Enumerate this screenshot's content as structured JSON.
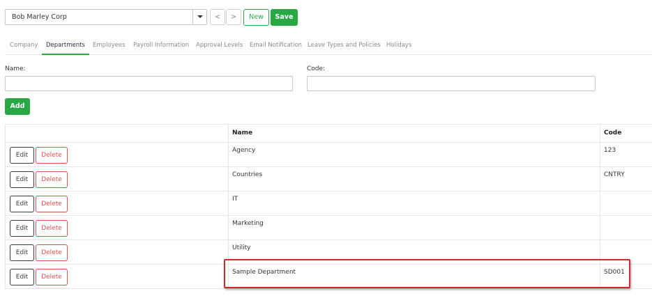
{
  "toolbar": {
    "company_value": "Bob Marley Corp",
    "prev_label": "<",
    "next_label": ">",
    "new_label": "New",
    "save_label": "Save"
  },
  "tabs": [
    {
      "label": "Company",
      "active": false
    },
    {
      "label": "Departments",
      "active": true
    },
    {
      "label": "Employees",
      "active": false
    },
    {
      "label": "Payroll Information",
      "active": false
    },
    {
      "label": "Approval Levels",
      "active": false
    },
    {
      "label": "Email Notification",
      "active": false
    },
    {
      "label": "Leave Types and Policies",
      "active": false
    },
    {
      "label": "Holidays",
      "active": false
    }
  ],
  "form": {
    "name_label": "Name:",
    "name_value": "",
    "code_label": "Code:",
    "code_value": "",
    "add_label": "Add"
  },
  "table": {
    "headers": {
      "actions": "",
      "name": "Name",
      "code": "Code"
    },
    "edit_label": "Edit",
    "delete_label": "Delete",
    "rows": [
      {
        "name": "Agency",
        "code": "123"
      },
      {
        "name": "Countries",
        "code": "CNTRY"
      },
      {
        "name": "IT",
        "code": ""
      },
      {
        "name": "Marketing",
        "code": ""
      },
      {
        "name": "Utility",
        "code": ""
      },
      {
        "name": "Sample Department",
        "code": "SD001"
      }
    ]
  },
  "colors": {
    "accent_green": "#28a745",
    "delete_red": "#d9534f",
    "highlight_red": "#d0282d"
  },
  "icons": {
    "dropdown": "chevron-down-icon",
    "prev": "chevron-left-icon",
    "next": "chevron-right-icon"
  }
}
